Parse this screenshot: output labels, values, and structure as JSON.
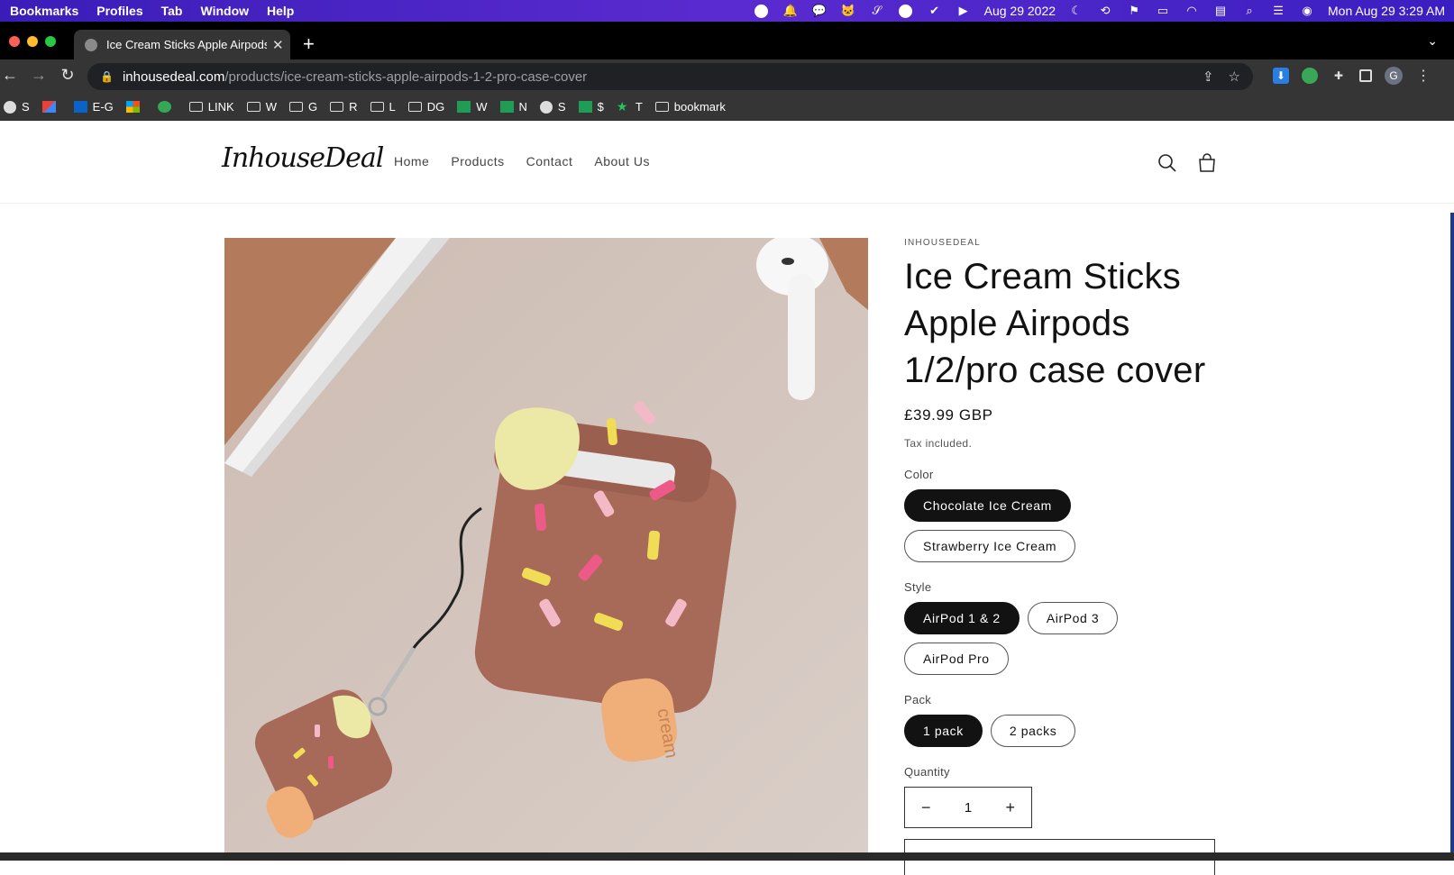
{
  "menubar": {
    "items": [
      "Bookmarks",
      "Profiles",
      "Tab",
      "Window",
      "Help"
    ],
    "date": "Aug 29 2022",
    "clock": "Mon Aug 29  3:29 AM"
  },
  "browser": {
    "tab_title": "Ice Cream Sticks Apple Airpods 1/2/pro case cover",
    "url_host": "inhousedeal.com",
    "url_path": "/products/ice-cream-sticks-apple-airpods-1-2-pro-case-cover",
    "profile_initial": "G",
    "bookmarks": [
      {
        "label": "S",
        "icon": "globe-icon"
      },
      {
        "label": "",
        "icon": "gmail-icon"
      },
      {
        "label": "E-G",
        "icon": "outlook-icon"
      },
      {
        "label": "",
        "icon": "microsoft-icon"
      },
      {
        "label": "",
        "icon": "grammarly-icon"
      },
      {
        "label": "LINK",
        "icon": "folder-icon"
      },
      {
        "label": "W",
        "icon": "folder-icon"
      },
      {
        "label": "G",
        "icon": "folder-icon"
      },
      {
        "label": "R",
        "icon": "folder-icon"
      },
      {
        "label": "L",
        "icon": "folder-icon"
      },
      {
        "label": "DG",
        "icon": "folder-icon"
      },
      {
        "label": "W",
        "icon": "sheets-icon"
      },
      {
        "label": "N",
        "icon": "sheets-icon"
      },
      {
        "label": "S",
        "icon": "globe-icon"
      },
      {
        "label": "$",
        "icon": "sheets-icon"
      },
      {
        "label": "T",
        "icon": "star-icon"
      },
      {
        "label": "bookmark",
        "icon": "folder-icon"
      }
    ]
  },
  "site": {
    "logo": "InhouseDeal",
    "nav": [
      "Home",
      "Products",
      "Contact",
      "About Us"
    ]
  },
  "product": {
    "vendor": "INHOUSEDEAL",
    "title": "Ice Cream Sticks Apple Airpods 1/2/pro case cover",
    "price": "£39.99 GBP",
    "tax_note": "Tax included.",
    "options": {
      "color_label": "Color",
      "color_values": [
        "Chocolate Ice Cream",
        "Strawberry Ice Cream"
      ],
      "style_label": "Style",
      "style_values": [
        "AirPod 1 & 2",
        "AirPod 3",
        "AirPod Pro"
      ],
      "pack_label": "Pack",
      "pack_values": [
        "1 pack",
        "2 packs"
      ]
    },
    "quantity_label": "Quantity",
    "quantity": "1",
    "image_text": "cream"
  },
  "colors": {
    "menubar": "#4a25c8",
    "selected_pill": "#121212"
  }
}
